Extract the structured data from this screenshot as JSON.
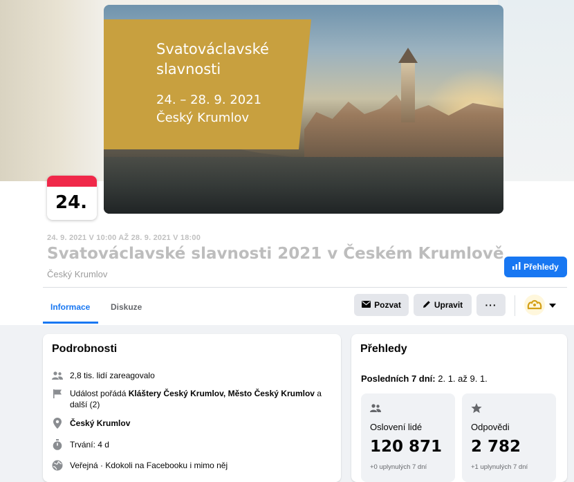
{
  "cover": {
    "title": "Svatováclavské slavnosti",
    "dates": "24. – 28. 9. 2021",
    "place": "Český Krumlov",
    "panel_color": "#c8a03f"
  },
  "date_badge": {
    "day": "24.",
    "accent": "#f02849"
  },
  "event": {
    "datetime": "24. 9. 2021 V 10:00 AŽ 28. 9. 2021 V 18:00",
    "title": "Svatováclavské slavnosti 2021 v Českém Krumlově",
    "location": "Český Krumlov"
  },
  "insights_button": {
    "label": "Přehledy",
    "icon": "bar-chart-icon",
    "color": "#1877f2"
  },
  "tabs": [
    {
      "label": "Informace",
      "active": true
    },
    {
      "label": "Diskuze",
      "active": false
    }
  ],
  "actions": {
    "invite": {
      "label": "Pozvat",
      "icon": "envelope-icon"
    },
    "edit": {
      "label": "Upravit",
      "icon": "pencil-icon"
    },
    "more": {
      "label": "···",
      "icon": "more-icon"
    },
    "profile": {
      "icon": "crown-logo-icon",
      "caret": "caret-down-icon"
    }
  },
  "details": {
    "title": "Podrobnosti",
    "reactions": "2,8 tis. lidí zareagovalo",
    "organizer_prefix": "Událost pořádá ",
    "organizer_names": "Kláštery Český Krumlov, Město Český Krumlov",
    "organizer_suffix": " a další (2)",
    "location": "Český Krumlov",
    "duration": "Trvání: 4 d",
    "privacy": "Veřejná · Kdokoli na Facebooku i mimo něj"
  },
  "insights": {
    "title": "Přehledy",
    "period_label": "Posledních 7 dní:",
    "period_range": " 2. 1. až 9. 1.",
    "reach": {
      "label": "Oslovení lidé",
      "value": "120 871",
      "sub": "+0 uplynulých 7 dní",
      "icon": "people-icon"
    },
    "responses": {
      "label": "Odpovědi",
      "value": "2 782",
      "sub": "+1 uplynulých 7 dní",
      "icon": "star-icon"
    }
  }
}
